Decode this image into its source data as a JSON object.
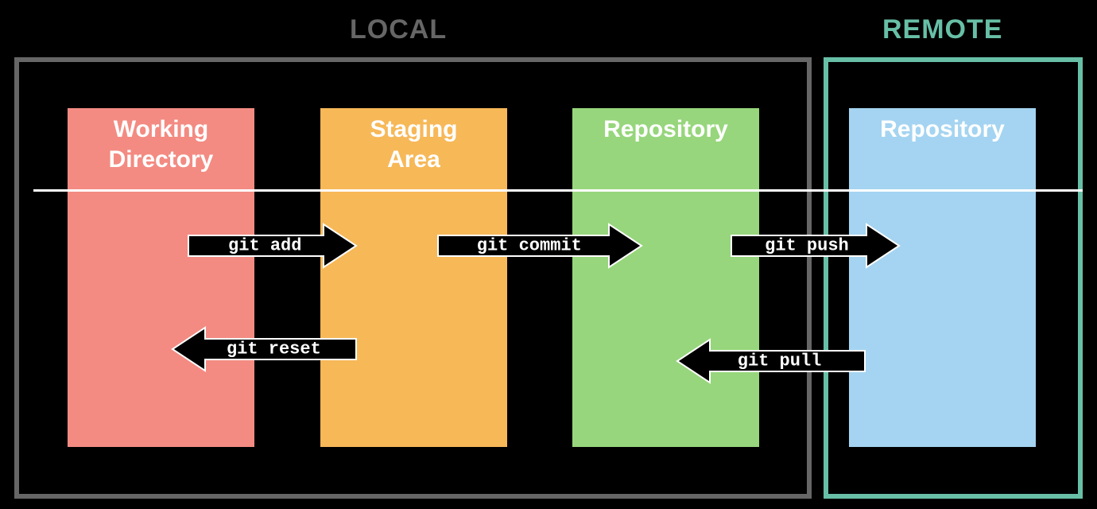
{
  "labels": {
    "local": "LOCAL",
    "remote": "REMOTE"
  },
  "columns": {
    "working": "Working Directory",
    "staging": "Staging Area",
    "repo_local": "Repository",
    "repo_remote": "Repository"
  },
  "commands": {
    "add": "git add",
    "commit": "git commit",
    "push": "git push",
    "reset": "git reset",
    "pull": "git pull"
  }
}
